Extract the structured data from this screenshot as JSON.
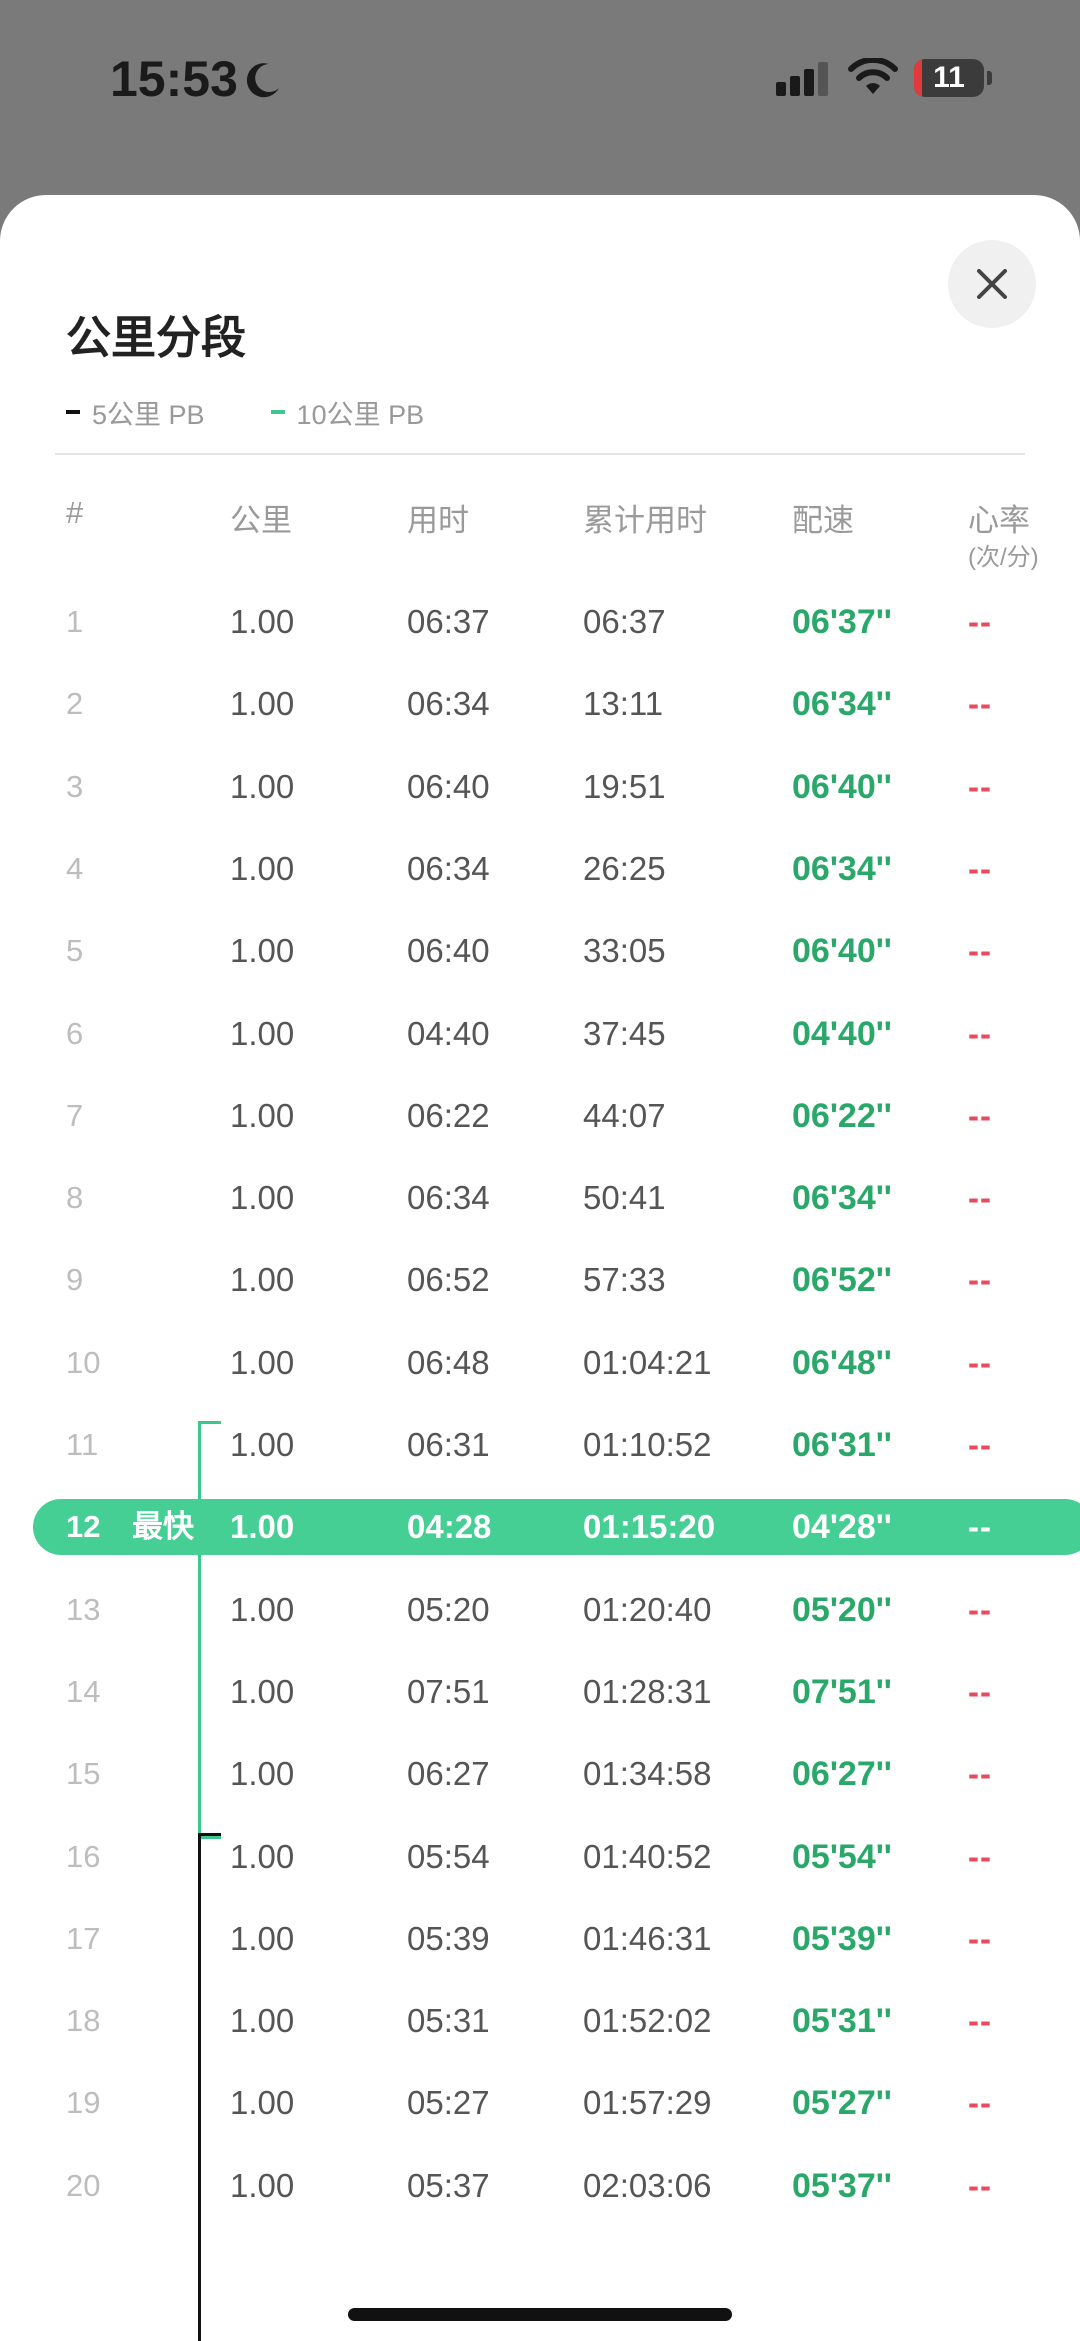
{
  "status": {
    "time": "15:53",
    "battery": "11"
  },
  "sheet": {
    "title": "公里分段",
    "legend": [
      {
        "label": "5公里 PB",
        "color": "#111111"
      },
      {
        "label": "10公里 PB",
        "color": "#3cc88c"
      }
    ],
    "headers": {
      "idx": "#",
      "km": "公里",
      "time": "用时",
      "cumulative": "累计用时",
      "pace": "配速",
      "hr": "心率",
      "hr_unit": "(次/分)"
    },
    "fastest_tag": "最快",
    "rows": [
      {
        "idx": "1",
        "km": "1.00",
        "time": "06:37",
        "cumulative": "06:37",
        "pace": "06'37''",
        "hr": "--"
      },
      {
        "idx": "2",
        "km": "1.00",
        "time": "06:34",
        "cumulative": "13:11",
        "pace": "06'34''",
        "hr": "--"
      },
      {
        "idx": "3",
        "km": "1.00",
        "time": "06:40",
        "cumulative": "19:51",
        "pace": "06'40''",
        "hr": "--"
      },
      {
        "idx": "4",
        "km": "1.00",
        "time": "06:34",
        "cumulative": "26:25",
        "pace": "06'34''",
        "hr": "--"
      },
      {
        "idx": "5",
        "km": "1.00",
        "time": "06:40",
        "cumulative": "33:05",
        "pace": "06'40''",
        "hr": "--"
      },
      {
        "idx": "6",
        "km": "1.00",
        "time": "04:40",
        "cumulative": "37:45",
        "pace": "04'40''",
        "hr": "--"
      },
      {
        "idx": "7",
        "km": "1.00",
        "time": "06:22",
        "cumulative": "44:07",
        "pace": "06'22''",
        "hr": "--"
      },
      {
        "idx": "8",
        "km": "1.00",
        "time": "06:34",
        "cumulative": "50:41",
        "pace": "06'34''",
        "hr": "--"
      },
      {
        "idx": "9",
        "km": "1.00",
        "time": "06:52",
        "cumulative": "57:33",
        "pace": "06'52''",
        "hr": "--"
      },
      {
        "idx": "10",
        "km": "1.00",
        "time": "06:48",
        "cumulative": "01:04:21",
        "pace": "06'48''",
        "hr": "--"
      },
      {
        "idx": "11",
        "km": "1.00",
        "time": "06:31",
        "cumulative": "01:10:52",
        "pace": "06'31''",
        "hr": "--"
      },
      {
        "idx": "12",
        "km": "1.00",
        "time": "04:28",
        "cumulative": "01:15:20",
        "pace": "04'28''",
        "hr": "--"
      },
      {
        "idx": "13",
        "km": "1.00",
        "time": "05:20",
        "cumulative": "01:20:40",
        "pace": "05'20''",
        "hr": "--"
      },
      {
        "idx": "14",
        "km": "1.00",
        "time": "07:51",
        "cumulative": "01:28:31",
        "pace": "07'51''",
        "hr": "--"
      },
      {
        "idx": "15",
        "km": "1.00",
        "time": "06:27",
        "cumulative": "01:34:58",
        "pace": "06'27''",
        "hr": "--"
      },
      {
        "idx": "16",
        "km": "1.00",
        "time": "05:54",
        "cumulative": "01:40:52",
        "pace": "05'54''",
        "hr": "--"
      },
      {
        "idx": "17",
        "km": "1.00",
        "time": "05:39",
        "cumulative": "01:46:31",
        "pace": "05'39''",
        "hr": "--"
      },
      {
        "idx": "18",
        "km": "1.00",
        "time": "05:31",
        "cumulative": "01:52:02",
        "pace": "05'31''",
        "hr": "--"
      },
      {
        "idx": "19",
        "km": "1.00",
        "time": "05:27",
        "cumulative": "01:57:29",
        "pace": "05'27''",
        "hr": "--"
      },
      {
        "idx": "20",
        "km": "1.00",
        "time": "05:37",
        "cumulative": "02:03:06",
        "pace": "05'37''",
        "hr": "--"
      }
    ]
  }
}
